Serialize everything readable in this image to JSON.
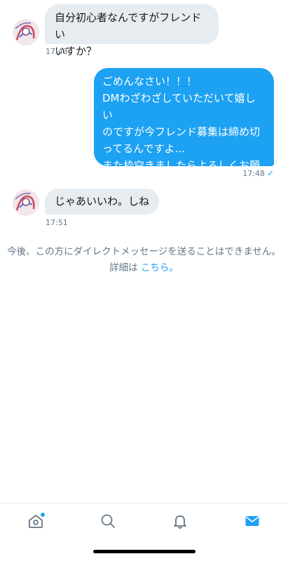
{
  "messages": [
    {
      "direction": "incoming",
      "text": "自分初心者なんですがフレンドい\nいすか？",
      "time": "17:43"
    },
    {
      "direction": "outgoing",
      "text": "ごめんなさい！！！\nDMわざわざしていただいて嬉しい\nのですが今フレンド募集は締め切\nってるんですよ...\nまた枠空きましたらよろしくお願\nいします！",
      "time": "17:48",
      "read_mark": "✓"
    },
    {
      "direction": "incoming",
      "text": "じゃあいいわ。しね",
      "time": "17:51"
    }
  ],
  "notice": {
    "text": "今後、この方にダイレクトメッセージを送ることはできません。詳細は ",
    "link_text": "こちら。"
  },
  "tabbar": {
    "items": [
      {
        "icon": "home-icon",
        "has_notification": true
      },
      {
        "icon": "search-icon",
        "has_notification": false
      },
      {
        "icon": "bell-icon",
        "has_notification": false
      },
      {
        "icon": "mail-icon",
        "has_notification": false,
        "active": true
      }
    ]
  },
  "colors": {
    "accent": "#1da1f2",
    "incoming_bubble": "#e6ecf0",
    "muted_text": "#657786"
  }
}
